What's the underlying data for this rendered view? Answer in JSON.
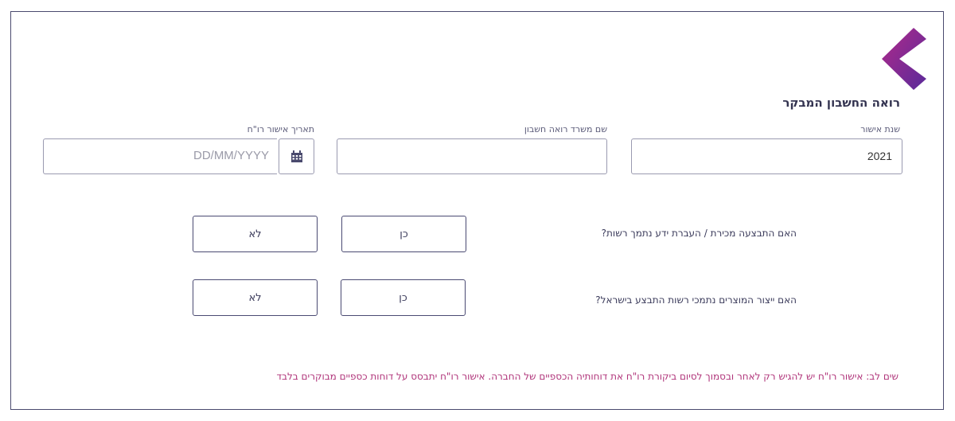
{
  "section_title": "רואה החשבון המבקר",
  "fields": {
    "approval_year": {
      "label": "שנת אישור",
      "value": "2021"
    },
    "firm_name": {
      "label": "שם משרד רואה חשבון",
      "value": ""
    },
    "approval_date": {
      "label": "תאריך אישור רו\"ח",
      "placeholder": "DD/MM/YYYY",
      "icon": "calendar-icon"
    }
  },
  "questions": [
    {
      "text": "האם התבצעה מכירת / העברת ידע נתמך רשות?",
      "yes_label": "כן",
      "no_label": "לא"
    },
    {
      "text": "האם ייצור המוצרים נתמכי רשות התבצע בישראל?",
      "yes_label": "כן",
      "no_label": "לא"
    }
  ],
  "note": "שים לב: אישור רו\"ח יש להגיש רק לאחר ובסמוך לסיום ביקורת רו\"ח את דוחותיה הכספיים של החברה. אישור רו\"ח יתבסס על דוחות כספיים מבוקרים בלבד",
  "colors": {
    "accent_purple": "#7b2fa0",
    "accent_magenta": "#b0347a",
    "border_dark": "#4a4a72"
  }
}
